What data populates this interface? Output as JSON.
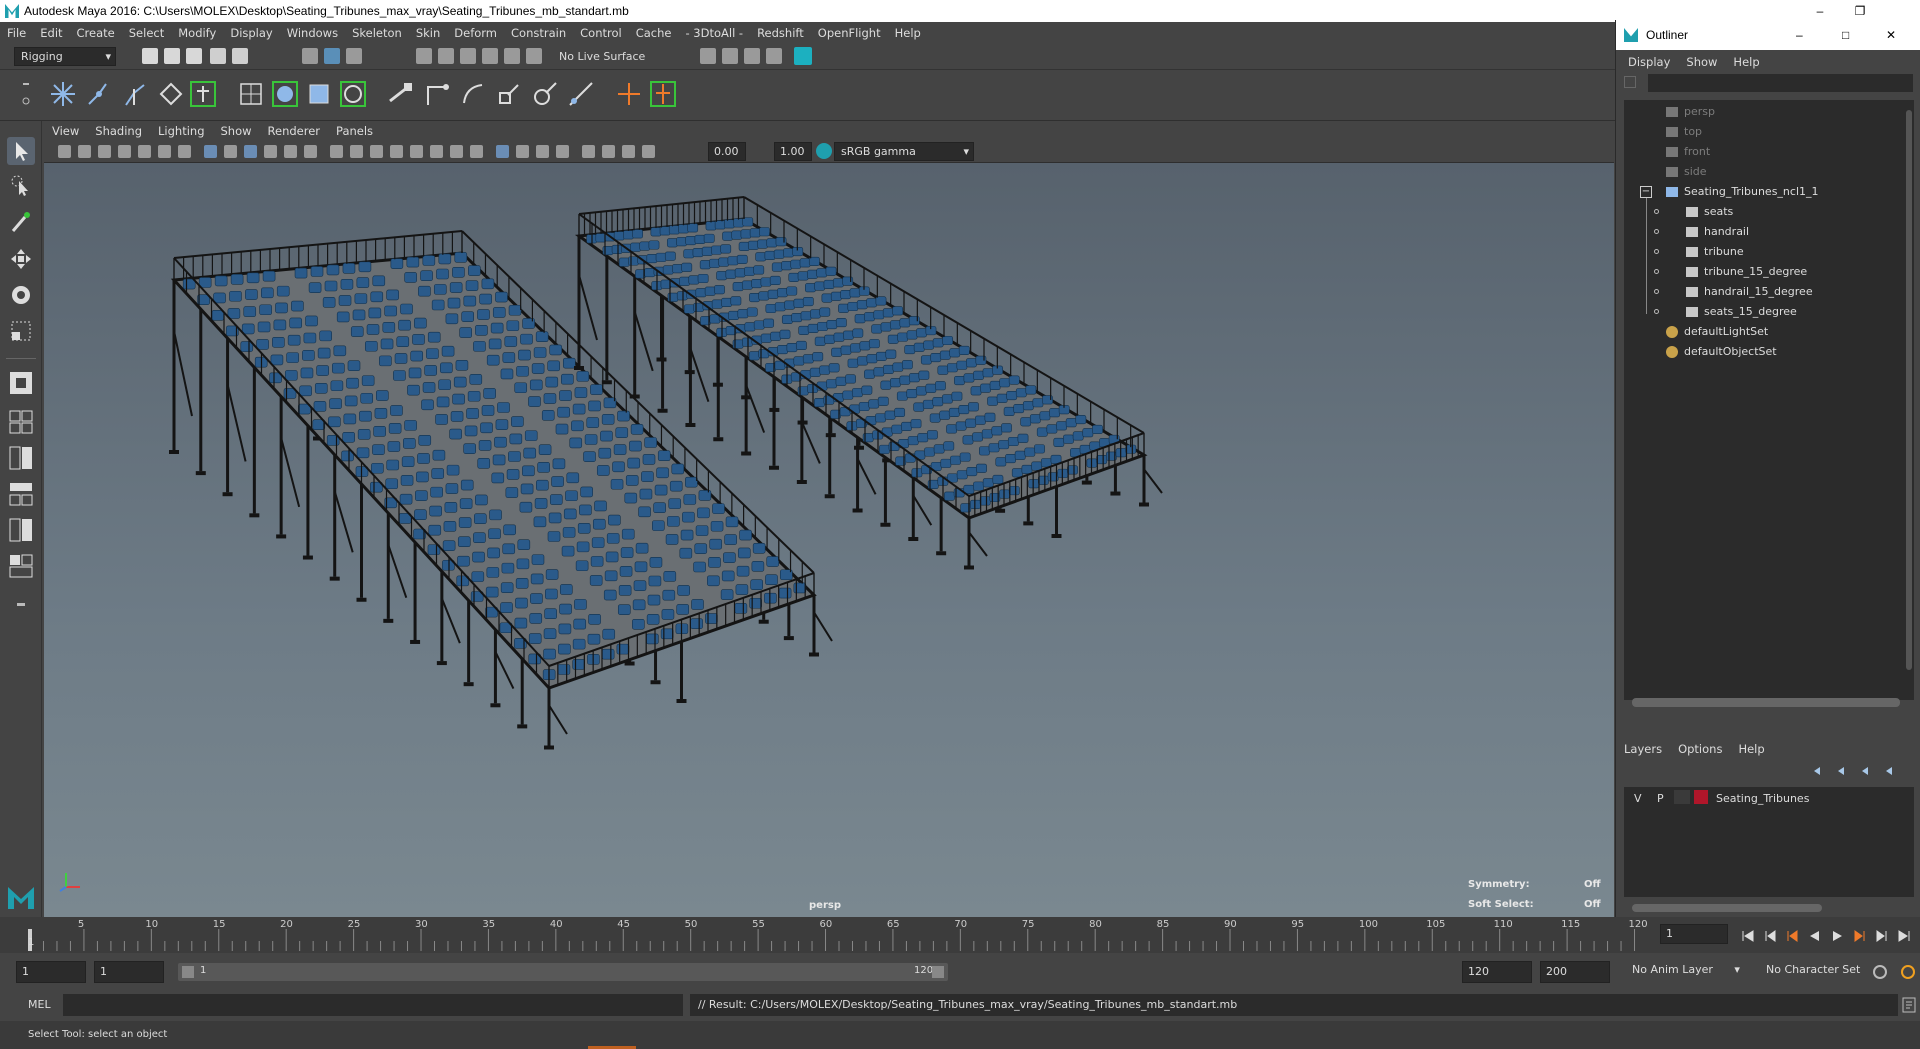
{
  "window": {
    "title": "Autodesk Maya 2016: C:\\Users\\MOLEX\\Desktop\\Seating_Tribunes_max_vray\\Seating_Tribunes_mb_standart.mb"
  },
  "menus": [
    "File",
    "Edit",
    "Create",
    "Select",
    "Modify",
    "Display",
    "Windows",
    "Skeleton",
    "Skin",
    "Deform",
    "Constrain",
    "Control",
    "Cache",
    "- 3DtoAll -",
    "Redshift",
    "OpenFlight",
    "Help"
  ],
  "status_line": {
    "mode": "Rigging",
    "live_surface": "No Live Surface"
  },
  "panel_menu": [
    "View",
    "Shading",
    "Lighting",
    "Show",
    "Renderer",
    "Panels"
  ],
  "panel_toolbar": {
    "exposure": "0.00",
    "gamma": "1.00",
    "color_space": "sRGB gamma"
  },
  "viewport": {
    "camera": "persp",
    "symmetry_label": "Symmetry:",
    "symmetry_value": "Off",
    "soft_select_label": "Soft Select:",
    "soft_select_value": "Off"
  },
  "outliner": {
    "title": "Outliner",
    "menu": [
      "Display",
      "Show",
      "Help"
    ],
    "cameras": [
      "persp",
      "top",
      "front",
      "side"
    ],
    "group": "Seating_Tribunes_ncl1_1",
    "children": [
      "seats",
      "handrail",
      "tribune",
      "tribune_15_degree",
      "handrail_15_degree",
      "seats_15_degree"
    ],
    "sets": [
      "defaultLightSet",
      "defaultObjectSet"
    ]
  },
  "layers": {
    "menu": [
      "Layers",
      "Options",
      "Help"
    ],
    "v": "V",
    "p": "P",
    "layer_name": "Seating_Tribunes",
    "layer_color": "#b0162a"
  },
  "timeline": {
    "ticks": [
      "5",
      "10",
      "15",
      "20",
      "25",
      "30",
      "35",
      "40",
      "45",
      "50",
      "55",
      "60",
      "65",
      "70",
      "75",
      "80",
      "85",
      "90",
      "95",
      "100",
      "105",
      "110",
      "115",
      "120"
    ],
    "start_marker": "1",
    "current_frame": "1"
  },
  "range": {
    "start": "1",
    "playback_start": "1",
    "slider_start": "1",
    "slider_end": "120",
    "playback_end": "120",
    "end": "200",
    "anim_layer": "No Anim Layer",
    "char_set": "No Character Set"
  },
  "command": {
    "lang": "MEL",
    "result": "// Result: C:/Users/MOLEX/Desktop/Seating_Tribunes_max_vray/Seating_Tribunes_mb_standart.mb"
  },
  "help_line": "Select Tool: select an object",
  "colors": {
    "seat": "#2a5a8a",
    "frame": "#141414",
    "accent": "#1f9fae"
  }
}
